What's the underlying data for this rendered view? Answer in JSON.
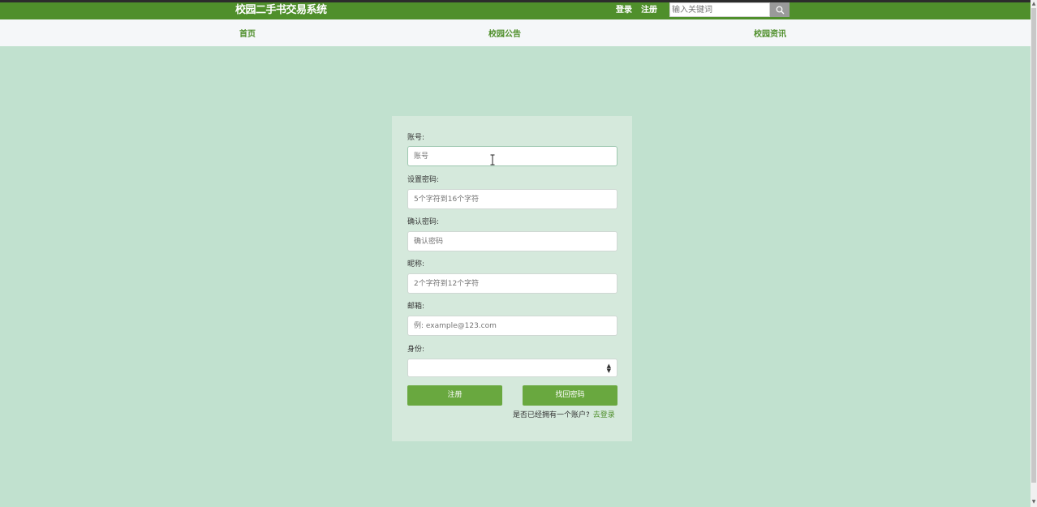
{
  "header": {
    "site_title": "校园二手书交易系统",
    "login_label": "登录",
    "register_label": "注册",
    "search_placeholder": "输入关键词",
    "search_icon": "search-icon"
  },
  "nav": {
    "items": [
      {
        "label": "首页"
      },
      {
        "label": "校园公告"
      },
      {
        "label": "校园资讯"
      }
    ]
  },
  "form": {
    "fields": [
      {
        "label": "账号:",
        "placeholder": "账号",
        "value": ""
      },
      {
        "label": "设置密码:",
        "placeholder": "5个字符到16个字符",
        "value": ""
      },
      {
        "label": "确认密码:",
        "placeholder": "确认密码",
        "value": ""
      },
      {
        "label": "昵称:",
        "placeholder": "2个字符到12个字符",
        "value": ""
      },
      {
        "label": "邮箱:",
        "placeholder": "例: example@123.com",
        "value": ""
      },
      {
        "label": "身份:",
        "selected": ""
      }
    ],
    "register_button": "注册",
    "find_password_button": "找回密码",
    "have_account_text": "是否已经拥有一个账户?",
    "go_login_link": "去登录"
  },
  "colors": {
    "header_green": "#4f8f2b",
    "button_green": "#69a83f",
    "page_bg": "#c1e1cf",
    "card_bg": "#d5e9dc"
  }
}
